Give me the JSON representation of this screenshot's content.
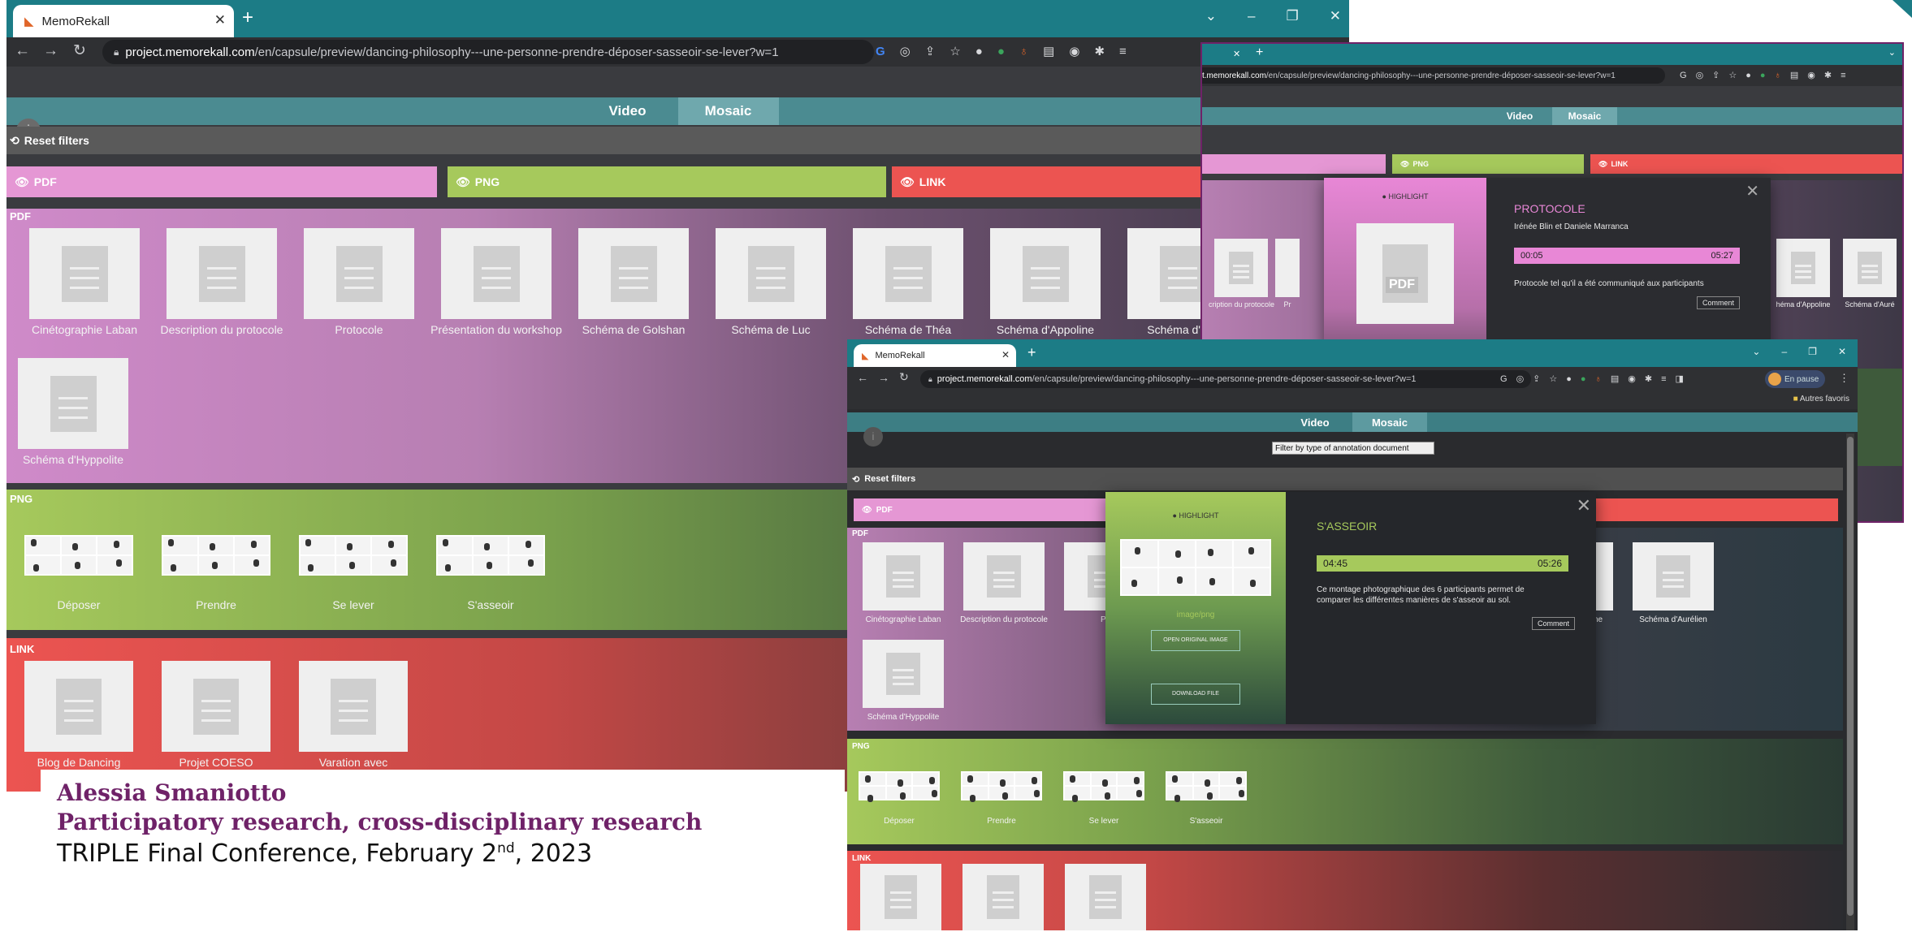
{
  "browser": {
    "tab_title": "MemoRekall",
    "url_host": "project.memorekall.com",
    "url_path": "/en/capsule/preview/dancing-philosophy---une-personne-prendre-déposer-sasseoir-se-lever?w=1",
    "url_host_partial": "t.memorekall.com",
    "profile_label": "En pause",
    "bookmark_label": "Autres favoris"
  },
  "app": {
    "mode_tabs": [
      "Video",
      "Mosaic"
    ],
    "active_mode": "Mosaic",
    "reset_filters": "Reset filters",
    "filter_select": "Filter by type of annotation document",
    "filters": [
      {
        "label": "PDF",
        "color": "#e597d4"
      },
      {
        "label": "PNG",
        "color": "#a6c95c"
      },
      {
        "label": "LINK",
        "color": "#ec5451"
      }
    ],
    "sections": {
      "pdf": {
        "label": "PDF",
        "items": [
          "Cinétographie Laban",
          "Description du protocole",
          "Protocole",
          "Présentation du workshop",
          "Schéma de Golshan",
          "Schéma de Luc",
          "Schéma de Théa",
          "Schéma d'Appoline",
          "Schéma d'Aur",
          "Schéma d'Hyppolite"
        ]
      },
      "png": {
        "label": "PNG",
        "items": [
          "Déposer",
          "Prendre",
          "Se lever",
          "S'asseoir"
        ]
      },
      "link": {
        "label": "LINK",
        "items": [
          "Blog de Dancing",
          "Projet COESO",
          "Varation avec chaises"
        ]
      }
    }
  },
  "window2": {
    "popup": {
      "highlight": "● HIGHLIGHT",
      "doc_badge": "PDF",
      "title": "PROTOCOLE",
      "authors": "Irénée Blin et Daniele Marranca",
      "time_start": "00:05",
      "time_end": "05:27",
      "text": "Protocole tel qu'il a été communiqué aux participants",
      "comment": "Comment"
    },
    "bg_items": [
      "cription du protocole",
      "Pr",
      "héma d'Appoline",
      "Schéma d'Auré"
    ]
  },
  "window3": {
    "pdf_items": [
      "Cinétographie Laban",
      "Description du protocole",
      "Pr",
      "héma d'Appoline",
      "Schéma d'Aurélien",
      "Schéma d'Hyppolite"
    ],
    "png_items": [
      "Déposer",
      "Prendre",
      "Se lever",
      "S'asseoir"
    ],
    "popup": {
      "highlight": "● HIGHLIGHT",
      "mime": "image/png",
      "open_btn": "OPEN ORIGINAL IMAGE",
      "download_btn": "DOWNLOAD FILE",
      "title": "S'ASSEOIR",
      "time_start": "04:45",
      "time_end": "05:26",
      "text": "Ce montage photographique des 6 participants permet de comparer les différentes manières de s'asseoir au sol.",
      "comment": "Comment"
    }
  },
  "caption": {
    "name": "Alessia Smaniotto",
    "subtitle": "Participatory research, cross-disciplinary research",
    "conference_pre": "TRIPLE Final Conference, February 2",
    "conference_sup": "nd",
    "conference_post": ", 2023"
  },
  "colors": {
    "teal": "#1c7c86",
    "pdf": "#e597d4",
    "png": "#a6c95c",
    "link": "#ec5451",
    "popup_pink": "#e887d6",
    "popup_green": "#a6c95c"
  },
  "icons": [
    "eye-icon",
    "refresh-icon",
    "info-icon",
    "document-icon",
    "close-icon",
    "extension-icon",
    "lock-icon"
  ]
}
